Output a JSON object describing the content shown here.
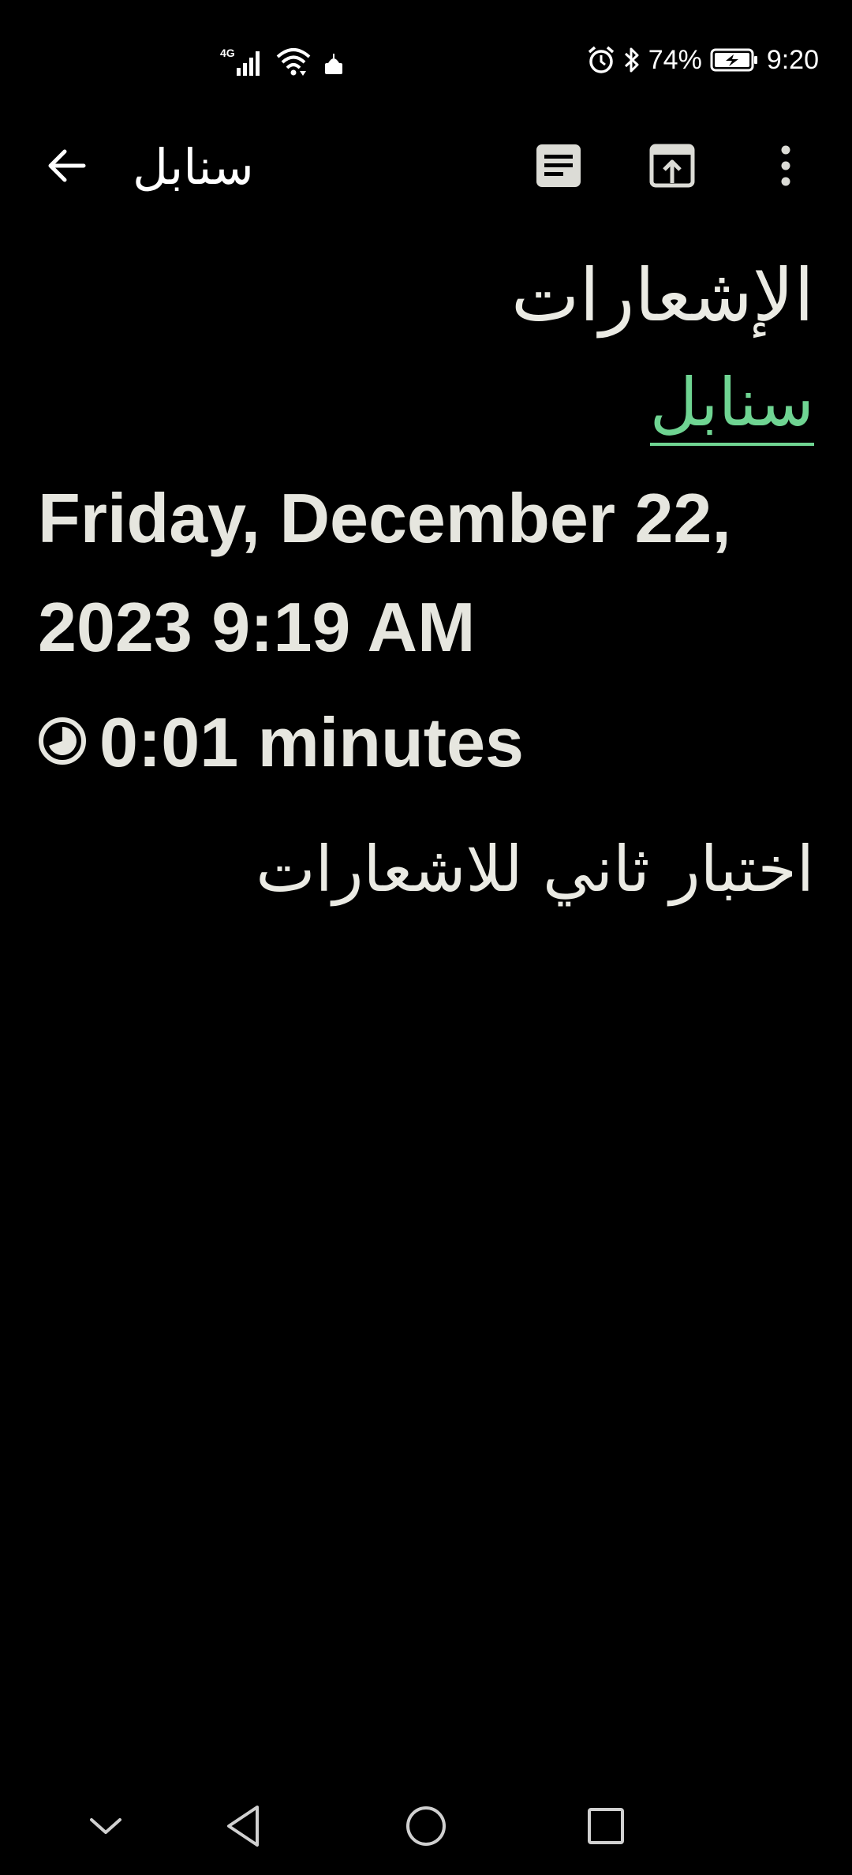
{
  "status_bar": {
    "network_type": "4G",
    "battery_percent": "74%",
    "time": "9:20",
    "icons": [
      "signal-icon",
      "wifi-icon",
      "notification-app-icon",
      "alarm-icon",
      "bluetooth-icon",
      "battery-charging-icon"
    ]
  },
  "app_bar": {
    "title": "سنابل",
    "back_icon": "arrow-back-icon",
    "actions": [
      "reader-view-icon",
      "open-in-browser-icon",
      "more-vert-icon"
    ]
  },
  "post": {
    "title": "الإشعارات",
    "author": "سنابل",
    "date": "Friday, December 22, 2023 9:19 AM",
    "read_time": "0:01 minutes",
    "body": "اختبار ثاني للاشعارات"
  },
  "nav_bar": {
    "buttons": [
      "collapse-icon",
      "back-triangle-icon",
      "home-circle-icon",
      "recents-square-icon"
    ]
  },
  "colors": {
    "background": "#000000",
    "text": "#e8e8e2",
    "link": "#6fd492"
  }
}
